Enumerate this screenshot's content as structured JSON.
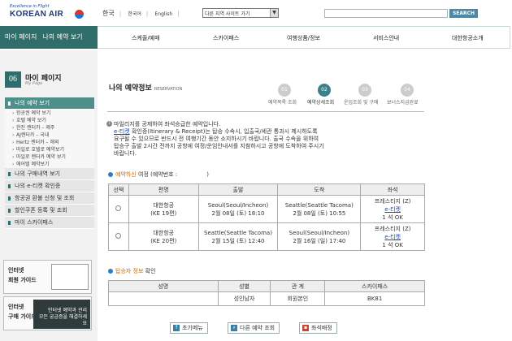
{
  "header": {
    "logo_tagline": "Excellence in Flight",
    "logo_brand": "KOREAN AIR",
    "lang_items": [
      "한국",
      "한국어",
      "English"
    ],
    "site_select": "다른 지역 사이트 가기",
    "search_button": "SEARCH"
  },
  "gnb": {
    "mypage_tabs": [
      "마이 페이지",
      "나의 예약 보기"
    ],
    "items": [
      "스케줄/예매",
      "스카이패스",
      "여행상품/정보",
      "서비스안내",
      "대한항공소개"
    ]
  },
  "sidebar": {
    "number": "06",
    "title": "마이 페이지",
    "subtitle": "My Page",
    "menu": [
      {
        "label": "나의 예약 보기",
        "type": "main",
        "active": true
      },
      {
        "label": "항공권 예약 보기",
        "type": "sub"
      },
      {
        "label": "호텔 예약 보기",
        "type": "sub"
      },
      {
        "label": "한진 렌터카 – 제주",
        "type": "sub"
      },
      {
        "label": "AJ렌터카 – 국내",
        "type": "sub"
      },
      {
        "label": "Hertz 렌터카 – 해외",
        "type": "sub"
      },
      {
        "label": "마일로 호텔로 예약보기",
        "type": "sub"
      },
      {
        "label": "마일로 렌터카 예약 보기",
        "type": "sub"
      },
      {
        "label": "에어텔 예약보기",
        "type": "sub"
      },
      {
        "label": "나의 구매내역 보기",
        "type": "main"
      },
      {
        "label": "나의 e-티켓 확인증",
        "type": "main"
      },
      {
        "label": "항공권 환불 신청 및 조회",
        "type": "main"
      },
      {
        "label": "할인쿠폰 등록 및 조회",
        "type": "main"
      },
      {
        "label": "마이 스카이패스",
        "type": "main"
      }
    ],
    "banner1": [
      "인터넷",
      "회원 가이드"
    ],
    "banner2_title": [
      "인터넷",
      "구매 가이드"
    ],
    "banner2_text": [
      "인터넷 예약과 관리",
      "모든 궁금증을 해결하세요"
    ]
  },
  "main": {
    "title": "나의 예약정보",
    "title_en": "RESERVATION",
    "steps": [
      {
        "num": "01",
        "label": "예약목록 조회",
        "active": false
      },
      {
        "num": "02",
        "label": "예약상세조회",
        "active": true
      },
      {
        "num": "03",
        "label": "운임조회 및 구매",
        "active": false
      },
      {
        "num": "04",
        "label": "보너스지급완료",
        "active": false
      }
    ],
    "notice_line1": "마일리지를 공제하여 좌석승급한 예약입니다.",
    "notice_link": "e-티켓",
    "notice_line2a": " 확인증(Itinerary & Receipt)는 탑승 수속시, 입출국/세관 통과시 제시하도록",
    "notice_line3": "요구될 수 있으므로 반드시 전 여행기간 동안 소지하시기 바랍니다. 출국 수속을 위하여",
    "notice_line4": "탑승구 출발 2시간 전까지 공항에 여정/운임안내서를 지참하시고 공항에 도착하여 주시기",
    "notice_line5": "바랍니다.",
    "itinerary_head_hl": "예약하신",
    "itinerary_head_rest": "여정",
    "itinerary_head_code": "(예약번호 :",
    "itinerary_head_close": ")",
    "flight_cols": [
      "선택",
      "편명",
      "출발",
      "도착",
      "좌석"
    ],
    "flights": [
      {
        "airline": "대한항공",
        "flight": "(KE 19편)",
        "dep_city": "Seoul(Seoul/Incheon)",
        "dep_time": "2월 08일 (토)   18:10",
        "arr_city": "Seattle(Seattle Tacoma)",
        "arr_time": "2월 08일 (토)   10:55",
        "cabin": "프레스티지 (Z)",
        "etk": "e-티켓",
        "seat": "1 석 OK"
      },
      {
        "airline": "대한항공",
        "flight": "(KE 20편)",
        "dep_city": "Seattle(Seattle Tacoma)",
        "dep_time": "2월 15일 (토)   12:40",
        "arr_city": "Seoul(Seoul/Incheon)",
        "arr_time": "2월 16일 (일)   17:40",
        "cabin": "프레스티지 (Z)",
        "etk": "e-티켓",
        "seat": "1 석 OK"
      }
    ],
    "pax_head_hl": "탑승자 정보",
    "pax_head_rest": "확인",
    "pax_cols": [
      "성명",
      "성별",
      "관 계",
      "스카이패스"
    ],
    "pax_rows": [
      {
        "name": "",
        "gender": "성인남자",
        "relation": "회원본인",
        "skypass": "BK81"
      }
    ],
    "buttons": [
      "초기메뉴",
      "다른 예약 조회",
      "좌석배정"
    ]
  }
}
